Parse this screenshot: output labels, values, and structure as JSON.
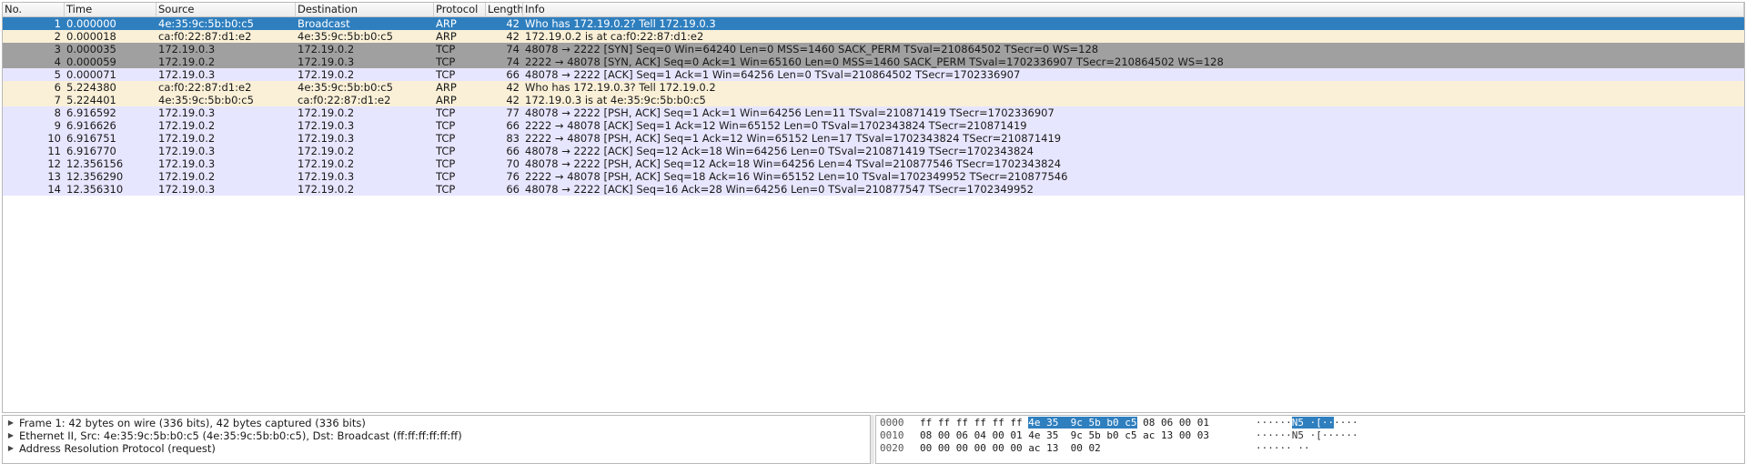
{
  "columns": {
    "no": "No.",
    "time": "Time",
    "source": "Source",
    "destination": "Destination",
    "protocol": "Protocol",
    "length": "Length",
    "info": "Info"
  },
  "colors": {
    "selected_bg": "#2f7fbf",
    "selected_fg": "#ffffff",
    "arp_bg": "#faf0d7",
    "tcp_bg": "#e7e6ff",
    "syn_bg": "#a0a0a0"
  },
  "packets": [
    {
      "no": "1",
      "time": "0.000000",
      "src": "4e:35:9c:5b:b0:c5",
      "dst": "Broadcast",
      "proto": "ARP",
      "len": "42",
      "info": "Who has 172.19.0.2? Tell 172.19.0.3",
      "style": "selected"
    },
    {
      "no": "2",
      "time": "0.000018",
      "src": "ca:f0:22:87:d1:e2",
      "dst": "4e:35:9c:5b:b0:c5",
      "proto": "ARP",
      "len": "42",
      "info": "172.19.0.2 is at ca:f0:22:87:d1:e2",
      "style": "arp"
    },
    {
      "no": "3",
      "time": "0.000035",
      "src": "172.19.0.3",
      "dst": "172.19.0.2",
      "proto": "TCP",
      "len": "74",
      "info": "48078 → 2222 [SYN] Seq=0 Win=64240 Len=0 MSS=1460 SACK_PERM TSval=210864502 TSecr=0 WS=128",
      "style": "syn"
    },
    {
      "no": "4",
      "time": "0.000059",
      "src": "172.19.0.2",
      "dst": "172.19.0.3",
      "proto": "TCP",
      "len": "74",
      "info": "2222 → 48078 [SYN, ACK] Seq=0 Ack=1 Win=65160 Len=0 MSS=1460 SACK_PERM TSval=1702336907 TSecr=210864502 WS=128",
      "style": "syn"
    },
    {
      "no": "5",
      "time": "0.000071",
      "src": "172.19.0.3",
      "dst": "172.19.0.2",
      "proto": "TCP",
      "len": "66",
      "info": "48078 → 2222 [ACK] Seq=1 Ack=1 Win=64256 Len=0 TSval=210864502 TSecr=1702336907",
      "style": "tcp"
    },
    {
      "no": "6",
      "time": "5.224380",
      "src": "ca:f0:22:87:d1:e2",
      "dst": "4e:35:9c:5b:b0:c5",
      "proto": "ARP",
      "len": "42",
      "info": "Who has 172.19.0.3? Tell 172.19.0.2",
      "style": "arp"
    },
    {
      "no": "7",
      "time": "5.224401",
      "src": "4e:35:9c:5b:b0:c5",
      "dst": "ca:f0:22:87:d1:e2",
      "proto": "ARP",
      "len": "42",
      "info": "172.19.0.3 is at 4e:35:9c:5b:b0:c5",
      "style": "arp"
    },
    {
      "no": "8",
      "time": "6.916592",
      "src": "172.19.0.3",
      "dst": "172.19.0.2",
      "proto": "TCP",
      "len": "77",
      "info": "48078 → 2222 [PSH, ACK] Seq=1 Ack=1 Win=64256 Len=11 TSval=210871419 TSecr=1702336907",
      "style": "tcp"
    },
    {
      "no": "9",
      "time": "6.916626",
      "src": "172.19.0.2",
      "dst": "172.19.0.3",
      "proto": "TCP",
      "len": "66",
      "info": "2222 → 48078 [ACK] Seq=1 Ack=12 Win=65152 Len=0 TSval=1702343824 TSecr=210871419",
      "style": "tcp"
    },
    {
      "no": "10",
      "time": "6.916751",
      "src": "172.19.0.2",
      "dst": "172.19.0.3",
      "proto": "TCP",
      "len": "83",
      "info": "2222 → 48078 [PSH, ACK] Seq=1 Ack=12 Win=65152 Len=17 TSval=1702343824 TSecr=210871419",
      "style": "tcp"
    },
    {
      "no": "11",
      "time": "6.916770",
      "src": "172.19.0.3",
      "dst": "172.19.0.2",
      "proto": "TCP",
      "len": "66",
      "info": "48078 → 2222 [ACK] Seq=12 Ack=18 Win=64256 Len=0 TSval=210871419 TSecr=1702343824",
      "style": "tcp"
    },
    {
      "no": "12",
      "time": "12.356156",
      "src": "172.19.0.3",
      "dst": "172.19.0.2",
      "proto": "TCP",
      "len": "70",
      "info": "48078 → 2222 [PSH, ACK] Seq=12 Ack=18 Win=64256 Len=4 TSval=210877546 TSecr=1702343824",
      "style": "tcp"
    },
    {
      "no": "13",
      "time": "12.356290",
      "src": "172.19.0.2",
      "dst": "172.19.0.3",
      "proto": "TCP",
      "len": "76",
      "info": "2222 → 48078 [PSH, ACK] Seq=18 Ack=16 Win=65152 Len=10 TSval=1702349952 TSecr=210877546",
      "style": "tcp"
    },
    {
      "no": "14",
      "time": "12.356310",
      "src": "172.19.0.3",
      "dst": "172.19.0.2",
      "proto": "TCP",
      "len": "66",
      "info": "48078 → 2222 [ACK] Seq=16 Ack=28 Win=64256 Len=0 TSval=210877547 TSecr=1702349952",
      "style": "tcp"
    }
  ],
  "details": [
    {
      "icon": "collapsed-arrow-icon",
      "text": "Frame 1: 42 bytes on wire (336 bits), 42 bytes captured (336 bits)"
    },
    {
      "icon": "collapsed-arrow-icon",
      "text": "Ethernet II, Src: 4e:35:9c:5b:b0:c5 (4e:35:9c:5b:b0:c5), Dst: Broadcast (ff:ff:ff:ff:ff:ff)"
    },
    {
      "icon": "collapsed-arrow-icon",
      "text": "Address Resolution Protocol (request)"
    }
  ],
  "hex_rows": [
    {
      "offset": "0000",
      "bytes": [
        "ff",
        "ff",
        "ff",
        "ff",
        "ff",
        "ff",
        "4e",
        "35",
        "9c",
        "5b",
        "b0",
        "c5",
        "08",
        "06",
        "00",
        "01"
      ],
      "hl_bytes": [
        6,
        11
      ],
      "ascii": "······N5 ·[······",
      "ascii_pre": "······",
      "ascii_hl": "N5 ·[··",
      "ascii_post": "····"
    },
    {
      "offset": "0010",
      "bytes": [
        "08",
        "00",
        "06",
        "04",
        "00",
        "01",
        "4e",
        "35",
        "9c",
        "5b",
        "b0",
        "c5",
        "ac",
        "13",
        "00",
        "03"
      ],
      "ascii": "······N5 ·[······"
    },
    {
      "offset": "0020",
      "bytes": [
        "00",
        "00",
        "00",
        "00",
        "00",
        "00",
        "ac",
        "13",
        "00",
        "02"
      ],
      "ascii": "······ ··"
    }
  ]
}
